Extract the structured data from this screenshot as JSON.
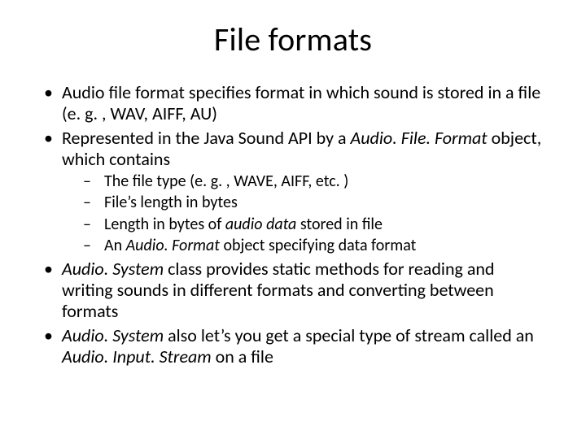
{
  "title": "File formats",
  "bullets": {
    "b1": "Audio file format specifies format in which sound is stored in a file (e. g. , WAV, AIFF, AU)",
    "b2_pre": "Represented in the Java Sound API by a ",
    "b2_em": "Audio. File. Format",
    "b2_post": " object, which contains",
    "sub1": "The file type (e. g. , WAVE, AIFF, etc. )",
    "sub2": "File’s length in bytes",
    "sub3_pre": "Length in bytes of ",
    "sub3_em": "audio data",
    "sub3_post": " stored in file",
    "sub4_pre": "An ",
    "sub4_em": "Audio. Format",
    "sub4_post": " object specifying data format",
    "b3_pre": "",
    "b3_em": "Audio. System",
    "b3_post": " class provides static methods for reading and writing sounds in different formats and converting between formats",
    "b4_pre": "",
    "b4_em1": "Audio. System",
    "b4_mid": " also let’s you get a special type of stream called an ",
    "b4_em2": "Audio. Input. Stream",
    "b4_post": " on a file"
  }
}
